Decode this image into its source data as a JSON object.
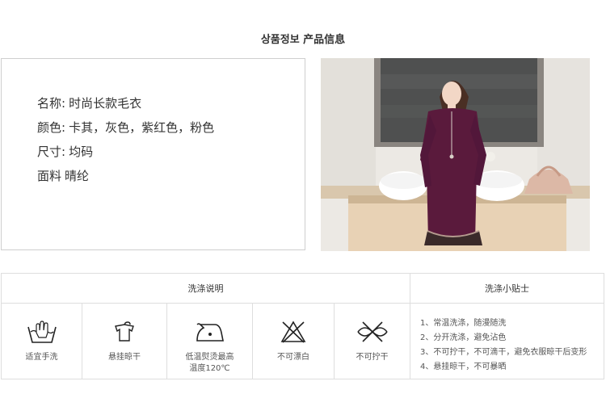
{
  "header": {
    "title": "상품정보 产品信息"
  },
  "product": {
    "rows": [
      {
        "key": "名称:",
        "value": "时尚长款毛衣"
      },
      {
        "key": "颜色:",
        "value": "卡其，灰色，紫红色，粉色"
      },
      {
        "key": "尺寸:",
        "value": "均码"
      },
      {
        "key": "面料",
        "value": "晴纶"
      }
    ]
  },
  "care": {
    "instructions_title": "洗涤说明",
    "tips_title": "洗涤小贴士",
    "icons": [
      {
        "label": "适宜手洗",
        "icon": "hand-wash-icon"
      },
      {
        "label": "悬挂晾干",
        "icon": "hang-dry-icon"
      },
      {
        "label": "低温熨烫最高温度120℃",
        "icon": "iron-low-icon"
      },
      {
        "label": "不可漂白",
        "icon": "no-bleach-icon"
      },
      {
        "label": "不可拧干",
        "icon": "no-wring-icon"
      }
    ],
    "tips": [
      "1、常温洗涤，随漫随洗",
      "2、分开洗涤，避免沾色",
      "3、不可拧干，不可滴干，避免衣服晾干后变形",
      "4、悬挂晾干，不可暴晒"
    ]
  }
}
